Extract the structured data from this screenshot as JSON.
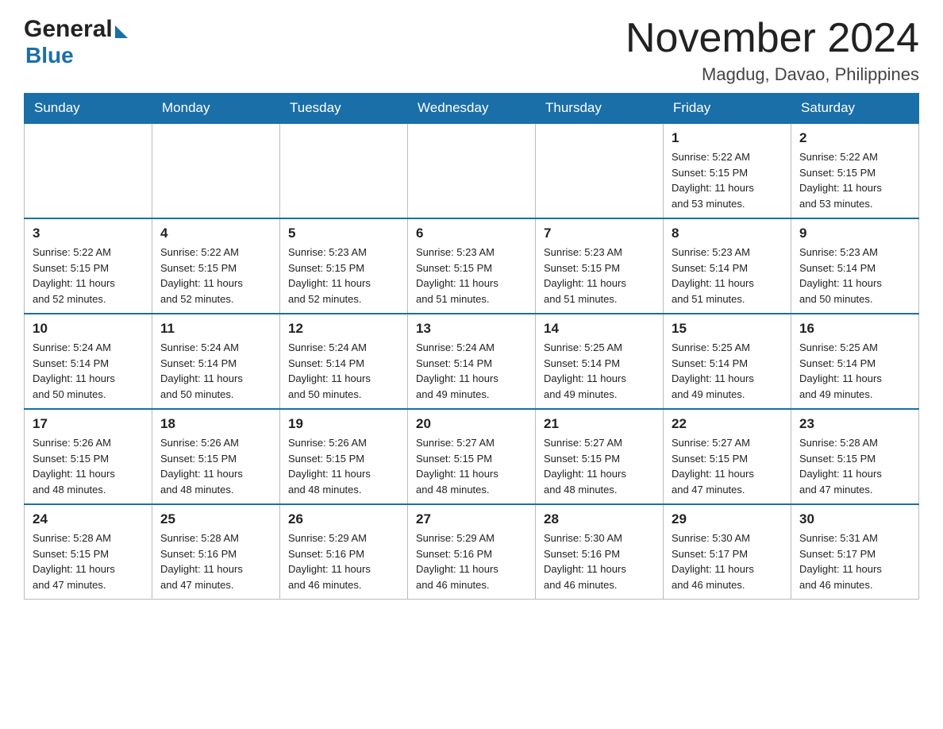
{
  "header": {
    "title": "November 2024",
    "subtitle": "Magdug, Davao, Philippines"
  },
  "logo": {
    "general": "General",
    "blue": "Blue"
  },
  "days_of_week": [
    "Sunday",
    "Monday",
    "Tuesday",
    "Wednesday",
    "Thursday",
    "Friday",
    "Saturday"
  ],
  "weeks": [
    [
      {
        "day": "",
        "info": ""
      },
      {
        "day": "",
        "info": ""
      },
      {
        "day": "",
        "info": ""
      },
      {
        "day": "",
        "info": ""
      },
      {
        "day": "",
        "info": ""
      },
      {
        "day": "1",
        "info": "Sunrise: 5:22 AM\nSunset: 5:15 PM\nDaylight: 11 hours\nand 53 minutes."
      },
      {
        "day": "2",
        "info": "Sunrise: 5:22 AM\nSunset: 5:15 PM\nDaylight: 11 hours\nand 53 minutes."
      }
    ],
    [
      {
        "day": "3",
        "info": "Sunrise: 5:22 AM\nSunset: 5:15 PM\nDaylight: 11 hours\nand 52 minutes."
      },
      {
        "day": "4",
        "info": "Sunrise: 5:22 AM\nSunset: 5:15 PM\nDaylight: 11 hours\nand 52 minutes."
      },
      {
        "day": "5",
        "info": "Sunrise: 5:23 AM\nSunset: 5:15 PM\nDaylight: 11 hours\nand 52 minutes."
      },
      {
        "day": "6",
        "info": "Sunrise: 5:23 AM\nSunset: 5:15 PM\nDaylight: 11 hours\nand 51 minutes."
      },
      {
        "day": "7",
        "info": "Sunrise: 5:23 AM\nSunset: 5:15 PM\nDaylight: 11 hours\nand 51 minutes."
      },
      {
        "day": "8",
        "info": "Sunrise: 5:23 AM\nSunset: 5:14 PM\nDaylight: 11 hours\nand 51 minutes."
      },
      {
        "day": "9",
        "info": "Sunrise: 5:23 AM\nSunset: 5:14 PM\nDaylight: 11 hours\nand 50 minutes."
      }
    ],
    [
      {
        "day": "10",
        "info": "Sunrise: 5:24 AM\nSunset: 5:14 PM\nDaylight: 11 hours\nand 50 minutes."
      },
      {
        "day": "11",
        "info": "Sunrise: 5:24 AM\nSunset: 5:14 PM\nDaylight: 11 hours\nand 50 minutes."
      },
      {
        "day": "12",
        "info": "Sunrise: 5:24 AM\nSunset: 5:14 PM\nDaylight: 11 hours\nand 50 minutes."
      },
      {
        "day": "13",
        "info": "Sunrise: 5:24 AM\nSunset: 5:14 PM\nDaylight: 11 hours\nand 49 minutes."
      },
      {
        "day": "14",
        "info": "Sunrise: 5:25 AM\nSunset: 5:14 PM\nDaylight: 11 hours\nand 49 minutes."
      },
      {
        "day": "15",
        "info": "Sunrise: 5:25 AM\nSunset: 5:14 PM\nDaylight: 11 hours\nand 49 minutes."
      },
      {
        "day": "16",
        "info": "Sunrise: 5:25 AM\nSunset: 5:14 PM\nDaylight: 11 hours\nand 49 minutes."
      }
    ],
    [
      {
        "day": "17",
        "info": "Sunrise: 5:26 AM\nSunset: 5:15 PM\nDaylight: 11 hours\nand 48 minutes."
      },
      {
        "day": "18",
        "info": "Sunrise: 5:26 AM\nSunset: 5:15 PM\nDaylight: 11 hours\nand 48 minutes."
      },
      {
        "day": "19",
        "info": "Sunrise: 5:26 AM\nSunset: 5:15 PM\nDaylight: 11 hours\nand 48 minutes."
      },
      {
        "day": "20",
        "info": "Sunrise: 5:27 AM\nSunset: 5:15 PM\nDaylight: 11 hours\nand 48 minutes."
      },
      {
        "day": "21",
        "info": "Sunrise: 5:27 AM\nSunset: 5:15 PM\nDaylight: 11 hours\nand 48 minutes."
      },
      {
        "day": "22",
        "info": "Sunrise: 5:27 AM\nSunset: 5:15 PM\nDaylight: 11 hours\nand 47 minutes."
      },
      {
        "day": "23",
        "info": "Sunrise: 5:28 AM\nSunset: 5:15 PM\nDaylight: 11 hours\nand 47 minutes."
      }
    ],
    [
      {
        "day": "24",
        "info": "Sunrise: 5:28 AM\nSunset: 5:15 PM\nDaylight: 11 hours\nand 47 minutes."
      },
      {
        "day": "25",
        "info": "Sunrise: 5:28 AM\nSunset: 5:16 PM\nDaylight: 11 hours\nand 47 minutes."
      },
      {
        "day": "26",
        "info": "Sunrise: 5:29 AM\nSunset: 5:16 PM\nDaylight: 11 hours\nand 46 minutes."
      },
      {
        "day": "27",
        "info": "Sunrise: 5:29 AM\nSunset: 5:16 PM\nDaylight: 11 hours\nand 46 minutes."
      },
      {
        "day": "28",
        "info": "Sunrise: 5:30 AM\nSunset: 5:16 PM\nDaylight: 11 hours\nand 46 minutes."
      },
      {
        "day": "29",
        "info": "Sunrise: 5:30 AM\nSunset: 5:17 PM\nDaylight: 11 hours\nand 46 minutes."
      },
      {
        "day": "30",
        "info": "Sunrise: 5:31 AM\nSunset: 5:17 PM\nDaylight: 11 hours\nand 46 minutes."
      }
    ]
  ],
  "colors": {
    "header_bg": "#1a6fa8",
    "header_text": "#ffffff",
    "border": "#bbbbbb",
    "empty_bg": "#f5f5f5"
  }
}
